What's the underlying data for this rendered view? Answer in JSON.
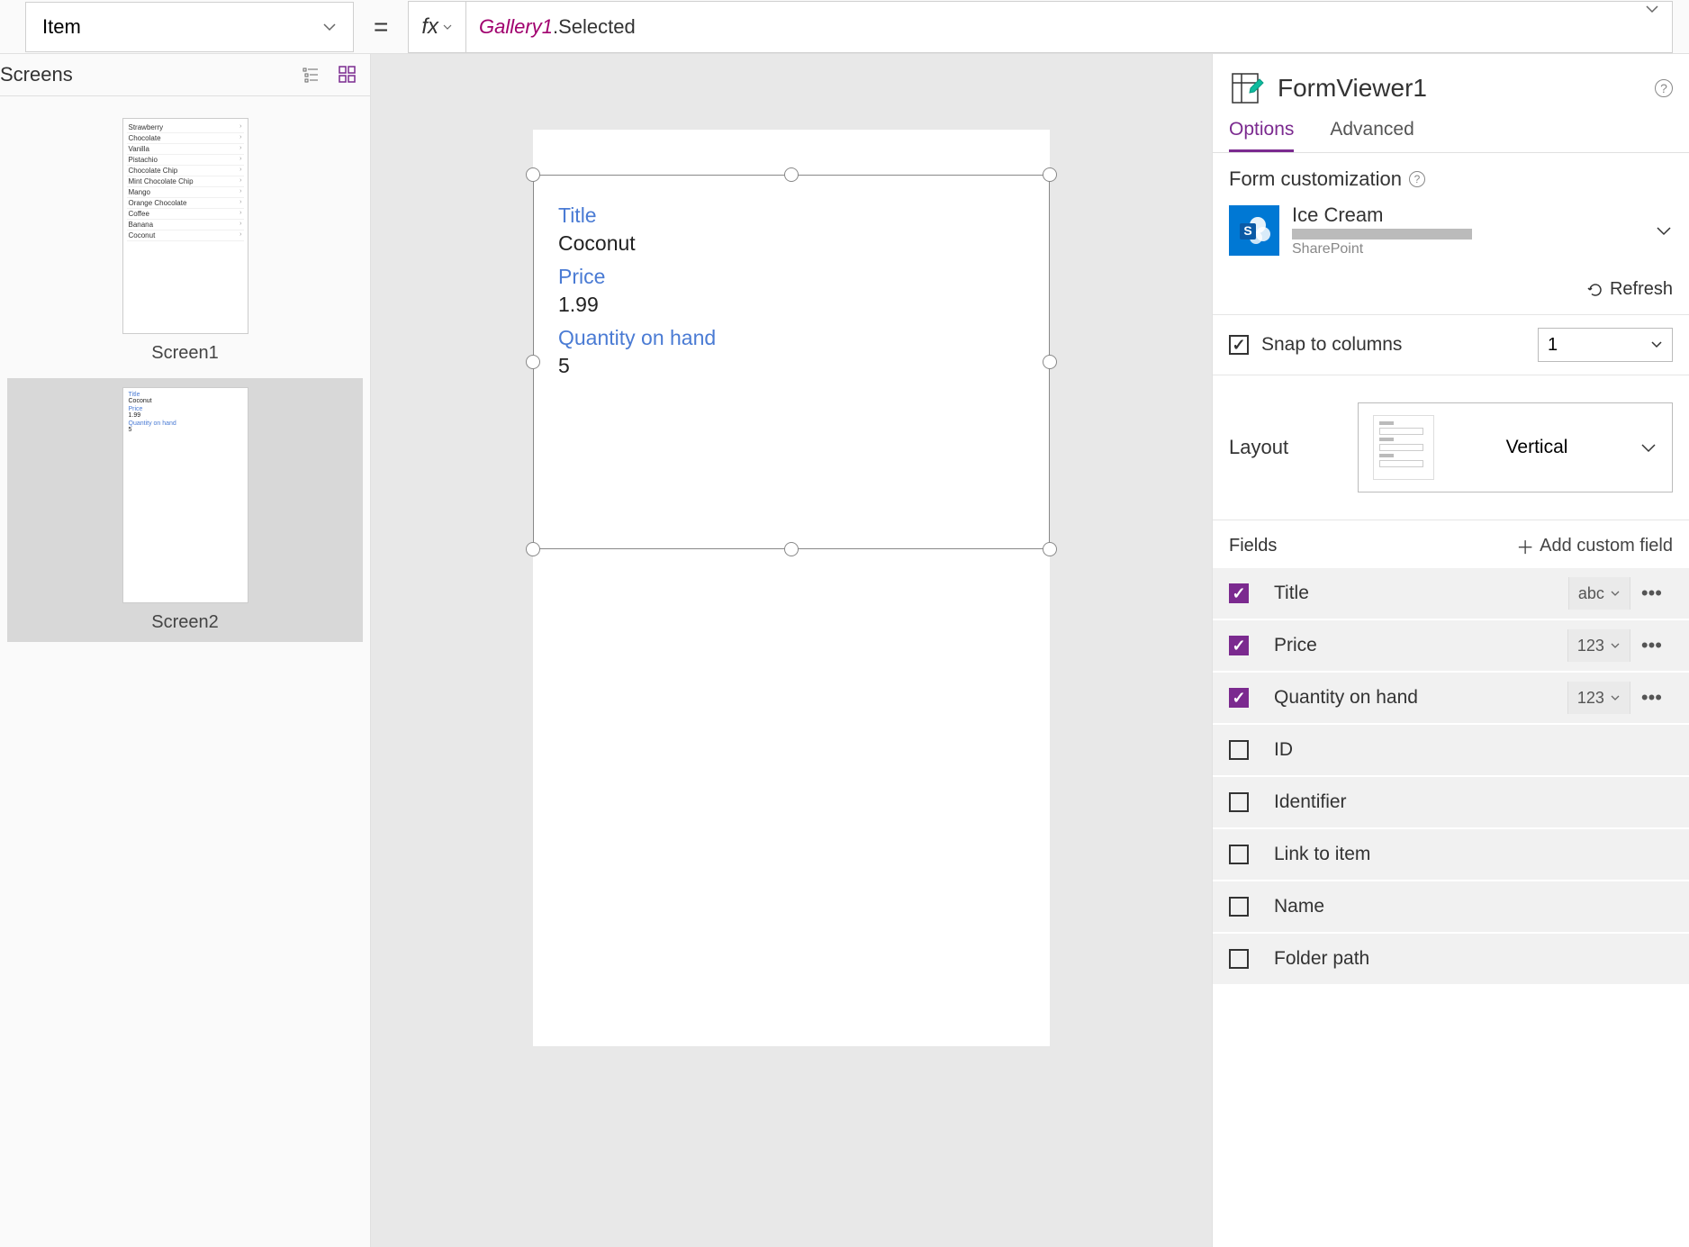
{
  "topbar": {
    "property": "Item",
    "equals": "=",
    "fx": "fx",
    "formula_ref": "Gallery1",
    "formula_prop": ".Selected"
  },
  "screens": {
    "title": "Screens",
    "items": [
      {
        "label": "Screen1"
      },
      {
        "label": "Screen2"
      }
    ],
    "thumb1_rows": [
      "Strawberry",
      "Chocolate",
      "Vanilla",
      "Pistachio",
      "Chocolate Chip",
      "Mint Chocolate Chip",
      "Mango",
      "Orange Chocolate",
      "Coffee",
      "Banana",
      "Coconut"
    ]
  },
  "form": {
    "fields": [
      {
        "label": "Title",
        "value": "Coconut"
      },
      {
        "label": "Price",
        "value": "1.99"
      },
      {
        "label": "Quantity on hand",
        "value": "5"
      }
    ]
  },
  "panel": {
    "name": "FormViewer1",
    "tabs": {
      "options": "Options",
      "advanced": "Advanced"
    },
    "customization": "Form customization",
    "datasource": {
      "name": "Ice Cream",
      "sub": "SharePoint"
    },
    "refresh": "Refresh",
    "snap_label": "Snap to columns",
    "columns": "1",
    "layout_label": "Layout",
    "layout_value": "Vertical",
    "fields_title": "Fields",
    "add_field": "Add custom field",
    "fields": [
      {
        "checked": true,
        "name": "Title",
        "type": "abc"
      },
      {
        "checked": true,
        "name": "Price",
        "type": "123"
      },
      {
        "checked": true,
        "name": "Quantity on hand",
        "type": "123"
      },
      {
        "checked": false,
        "name": "ID"
      },
      {
        "checked": false,
        "name": "Identifier"
      },
      {
        "checked": false,
        "name": "Link to item"
      },
      {
        "checked": false,
        "name": "Name"
      },
      {
        "checked": false,
        "name": "Folder path"
      }
    ]
  }
}
